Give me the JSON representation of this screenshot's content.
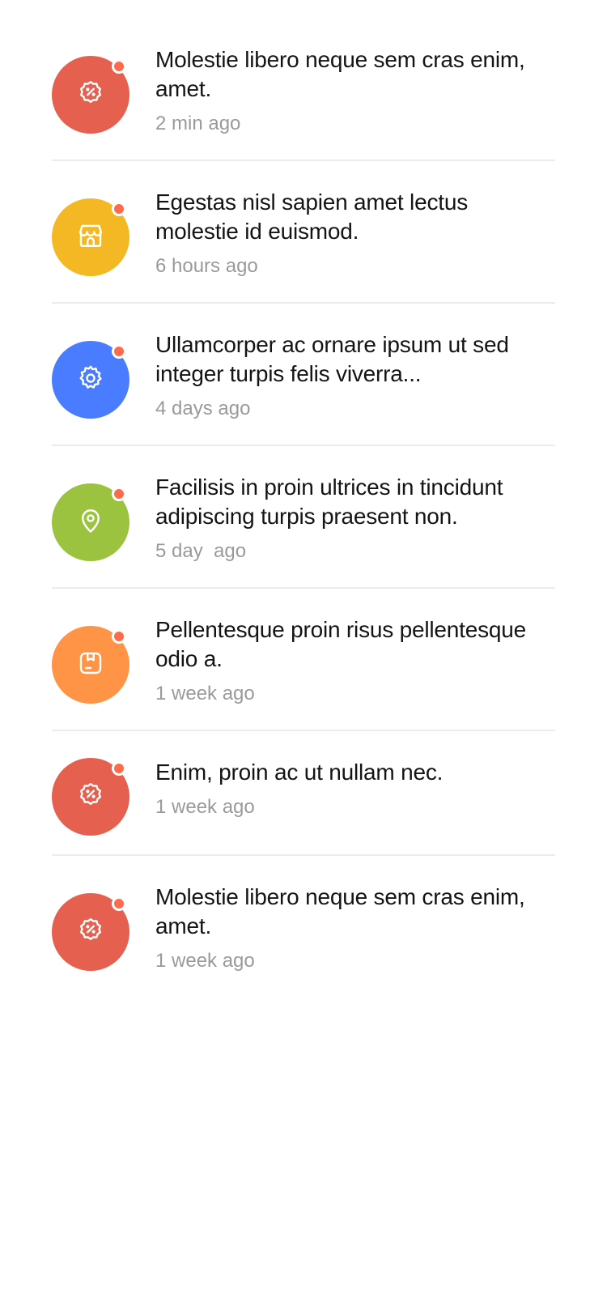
{
  "colors": {
    "red": "#e5604f",
    "yellow": "#f3b823",
    "blue": "#4a7cff",
    "green": "#9bc33f",
    "orange": "#ff9447",
    "unread_dot": "#ff6b4a",
    "divider": "#ececec",
    "time_text": "#9a9a9a"
  },
  "notifications": [
    {
      "icon": "discount-badge-icon",
      "color": "#e5604f",
      "title": "Molestie libero neque sem cras enim, amet.",
      "time": "2 min ago"
    },
    {
      "icon": "store-icon",
      "color": "#f3b823",
      "title": "Egestas nisl sapien amet lectus molestie id euismod.",
      "time": "6 hours ago"
    },
    {
      "icon": "gear-icon",
      "color": "#4a7cff",
      "title": "Ullamcorper ac ornare ipsum ut sed integer turpis felis viverra...",
      "time": "4 days ago"
    },
    {
      "icon": "location-pin-icon",
      "color": "#9bc33f",
      "title": "Facilisis in proin ultrices in tincidunt adipiscing turpis praesent non.",
      "time": "5 day  ago"
    },
    {
      "icon": "package-box-icon",
      "color": "#ff9447",
      "title": "Pellentesque proin risus pellentesque odio a.",
      "time": "1 week ago"
    },
    {
      "icon": "discount-badge-icon",
      "color": "#e5604f",
      "title": "Enim, proin ac ut nullam nec.",
      "time": "1 week ago"
    },
    {
      "icon": "discount-badge-icon",
      "color": "#e5604f",
      "title": "Molestie libero neque sem cras enim, amet.",
      "time": "1 week ago"
    }
  ]
}
